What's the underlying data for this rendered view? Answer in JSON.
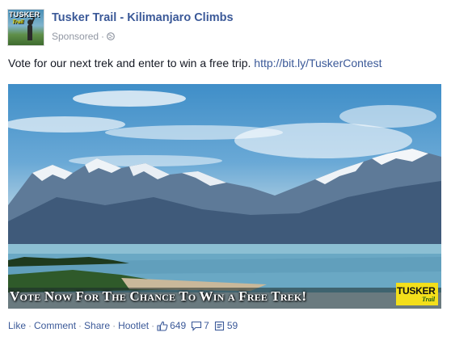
{
  "post": {
    "page_name": "Tusker Trail - Kilimanjaro Climbs",
    "sponsored_label": "Sponsored",
    "separator": "·",
    "message_text": "Vote for our next trek and enter to win a free trip.",
    "message_link": "http://bit.ly/TuskerContest",
    "avatar_logo": "TUSKER",
    "avatar_logo_sub": "Trail",
    "image_banner_text": "Vote Now For The Chance To Win a Free Trek!",
    "image_badge_text": "TUSKER",
    "image_badge_sub": "Trail"
  },
  "actions": {
    "like_label": "Like",
    "comment_label": "Comment",
    "share_label": "Share",
    "hootlet_label": "Hootlet",
    "likes_count": "649",
    "comments_count": "7",
    "shares_count": "59"
  },
  "colors": {
    "link": "#3b5998",
    "meta": "#9197a3",
    "text": "#141823",
    "badge": "#f3df1b"
  }
}
